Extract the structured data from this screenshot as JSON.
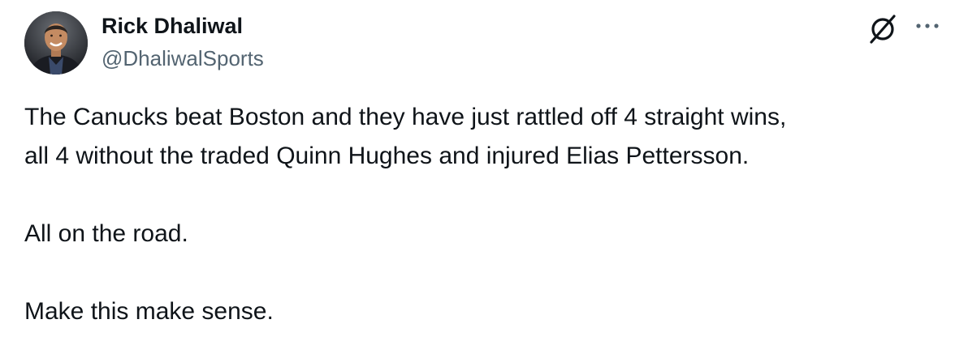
{
  "author": {
    "display_name": "Rick Dhaliwal",
    "handle": "@DhaliwalSports",
    "avatar_icon": "profile-photo"
  },
  "actions": {
    "grok_icon": "grok-icon",
    "more_icon": "more-options-icon"
  },
  "tweet": {
    "line1": "The Canucks beat Boston and they have just rattled off 4 straight wins,",
    "line2": "all 4 without the traded Quinn Hughes and injured Elias Pettersson.",
    "line3": "All on the road.",
    "line4": "Make this make sense."
  },
  "colors": {
    "text_primary": "#0f1419",
    "text_secondary": "#536471",
    "background": "#ffffff"
  }
}
